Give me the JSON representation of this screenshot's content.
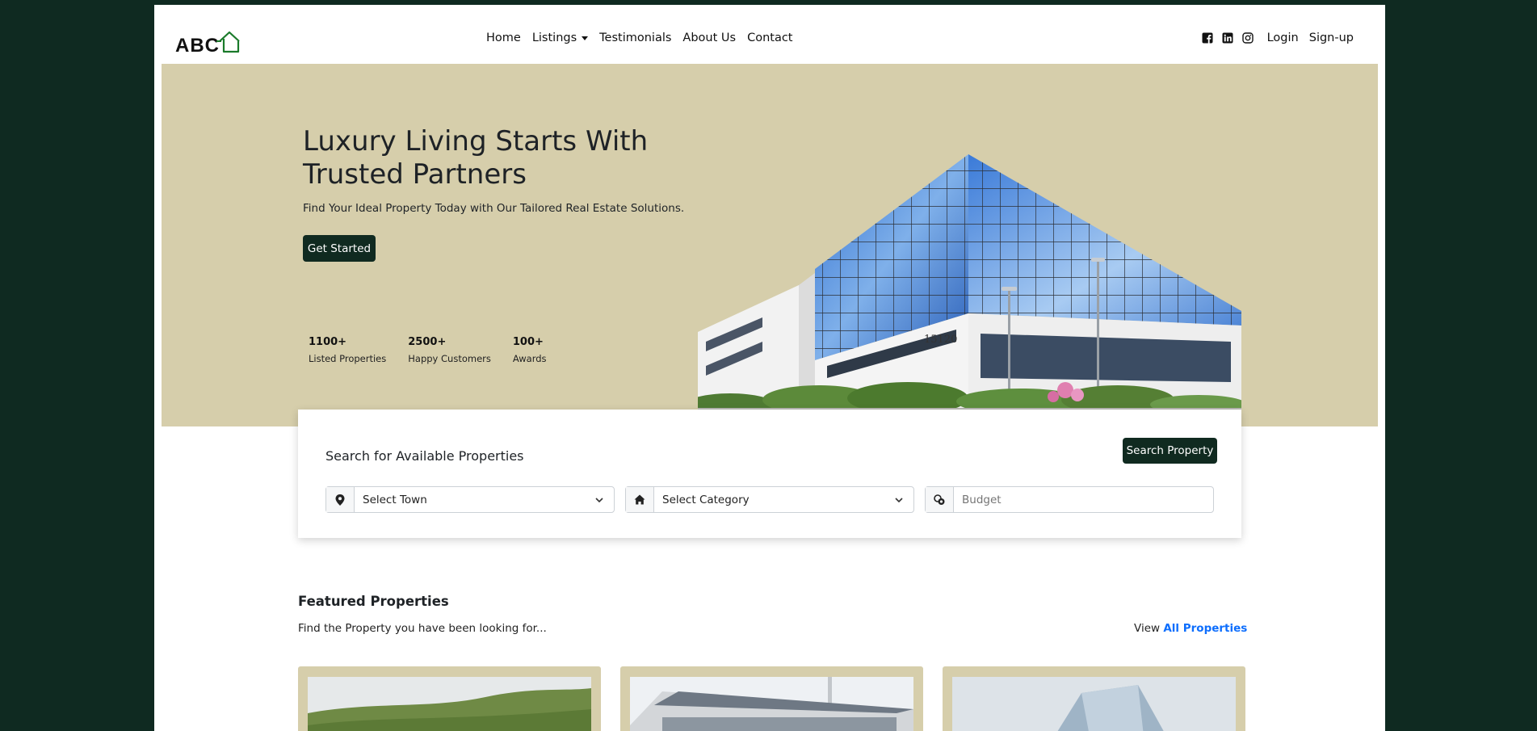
{
  "brand": {
    "logo_text": "ABC"
  },
  "nav": {
    "links": [
      {
        "label": "Home"
      },
      {
        "label": "Listings"
      },
      {
        "label": "Testimonials"
      },
      {
        "label": "About Us"
      },
      {
        "label": "Contact"
      }
    ],
    "social_icons": [
      "facebook-icon",
      "linkedin-icon",
      "instagram-icon"
    ],
    "login_label": "Login",
    "signup_label": "Sign-up"
  },
  "hero": {
    "title": "Luxury Living Starts With Trusted Partners",
    "subtitle": "Find Your Ideal Property Today with Our Tailored Real Estate Solutions.",
    "cta_label": "Get Started",
    "image_text": "15120",
    "stats": [
      {
        "value": "1100+",
        "label": "Listed Properties"
      },
      {
        "value": "2500+",
        "label": "Happy Customers"
      },
      {
        "value": "100+",
        "label": "Awards"
      }
    ]
  },
  "search": {
    "title": "Search for Available Properties",
    "button_label": "Search Property",
    "town": {
      "selected": "Select Town",
      "icon": "location-pin-icon"
    },
    "category": {
      "selected": "Select Category",
      "icon": "house-icon"
    },
    "budget": {
      "placeholder": "Budget",
      "icon": "coins-icon"
    }
  },
  "featured": {
    "title": "Featured Properties",
    "subtitle": "Find the Property you have been looking for...",
    "view_prefix": "View",
    "view_link": "All Properties"
  },
  "colors": {
    "outer_background": "#0f2a21",
    "hero_background": "#d6ceab",
    "button_dark": "#102a20",
    "link_blue": "#0d6efd",
    "logo_green": "#1a7a2a"
  }
}
